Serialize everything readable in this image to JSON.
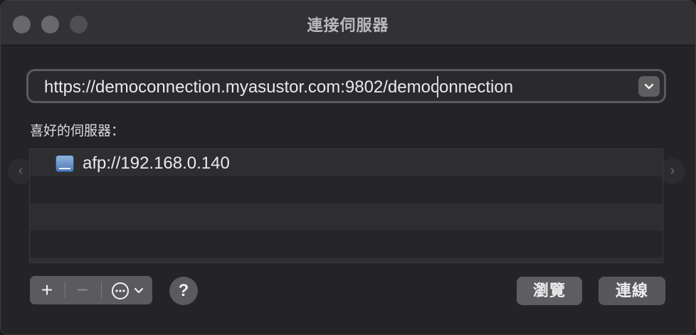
{
  "window": {
    "title": "連接伺服器"
  },
  "address": {
    "value": "https://democonnection.myasustor.com:9802/democonnection",
    "dropdown_icon": "chevron-down-icon"
  },
  "favorites": {
    "label": "喜好的伺服器：",
    "items": [
      {
        "label": "afp://192.168.0.140",
        "icon": "server-icon"
      }
    ]
  },
  "toolbar": {
    "add_label": "+",
    "remove_label": "−",
    "more_label": "⋯",
    "help_label": "?"
  },
  "buttons": {
    "browse": "瀏覽",
    "connect": "連線"
  },
  "colors": {
    "window_bg": "#242426",
    "titlebar_bg": "#323234",
    "button_bg": "#5e5e60",
    "text": "#ebebed"
  }
}
